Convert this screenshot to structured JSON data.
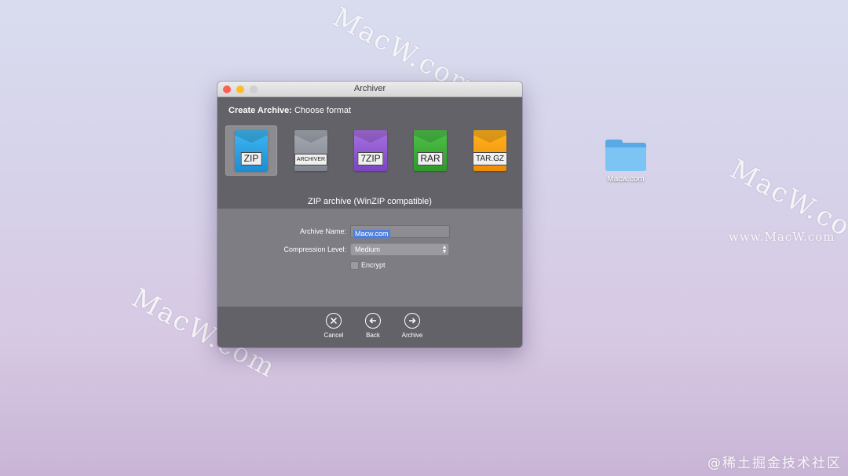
{
  "watermarks": {
    "w1": "MacW.com",
    "w2": "MacW.co",
    "w3": "MacW.com",
    "w4": "www.MacW.com",
    "w5": "@稀土掘金技术社区"
  },
  "desktop": {
    "folder_label": "Macw.com"
  },
  "window": {
    "title": "Archiver",
    "heading_bold": "Create Archive:",
    "heading_rest": " Choose format",
    "formats": [
      {
        "label": "ZIP",
        "icon": "zip-archive-icon",
        "color": "#1d8ed4",
        "selected": true
      },
      {
        "label": "ARCHIVER",
        "icon": "archiver-archive-icon",
        "color": "#7f848e",
        "selected": false
      },
      {
        "label": "7ZIP",
        "icon": "7zip-archive-icon",
        "color": "#7b45c4",
        "selected": false
      },
      {
        "label": "RAR",
        "icon": "rar-archive-icon",
        "color": "#2d9a29",
        "selected": false
      },
      {
        "label": "TAR.GZ",
        "icon": "targz-archive-icon",
        "color": "#ef8c07",
        "selected": false
      }
    ],
    "format_description": "ZIP archive (WinZIP compatible)",
    "form": {
      "archive_name_label": "Archive Name:",
      "archive_name_value": "Macw.com",
      "compression_label": "Compression Level:",
      "compression_value": "Medium",
      "encrypt_label": "Encrypt",
      "encrypt_checked": false
    },
    "actions": {
      "cancel": "Cancel",
      "back": "Back",
      "archive": "Archive"
    }
  }
}
